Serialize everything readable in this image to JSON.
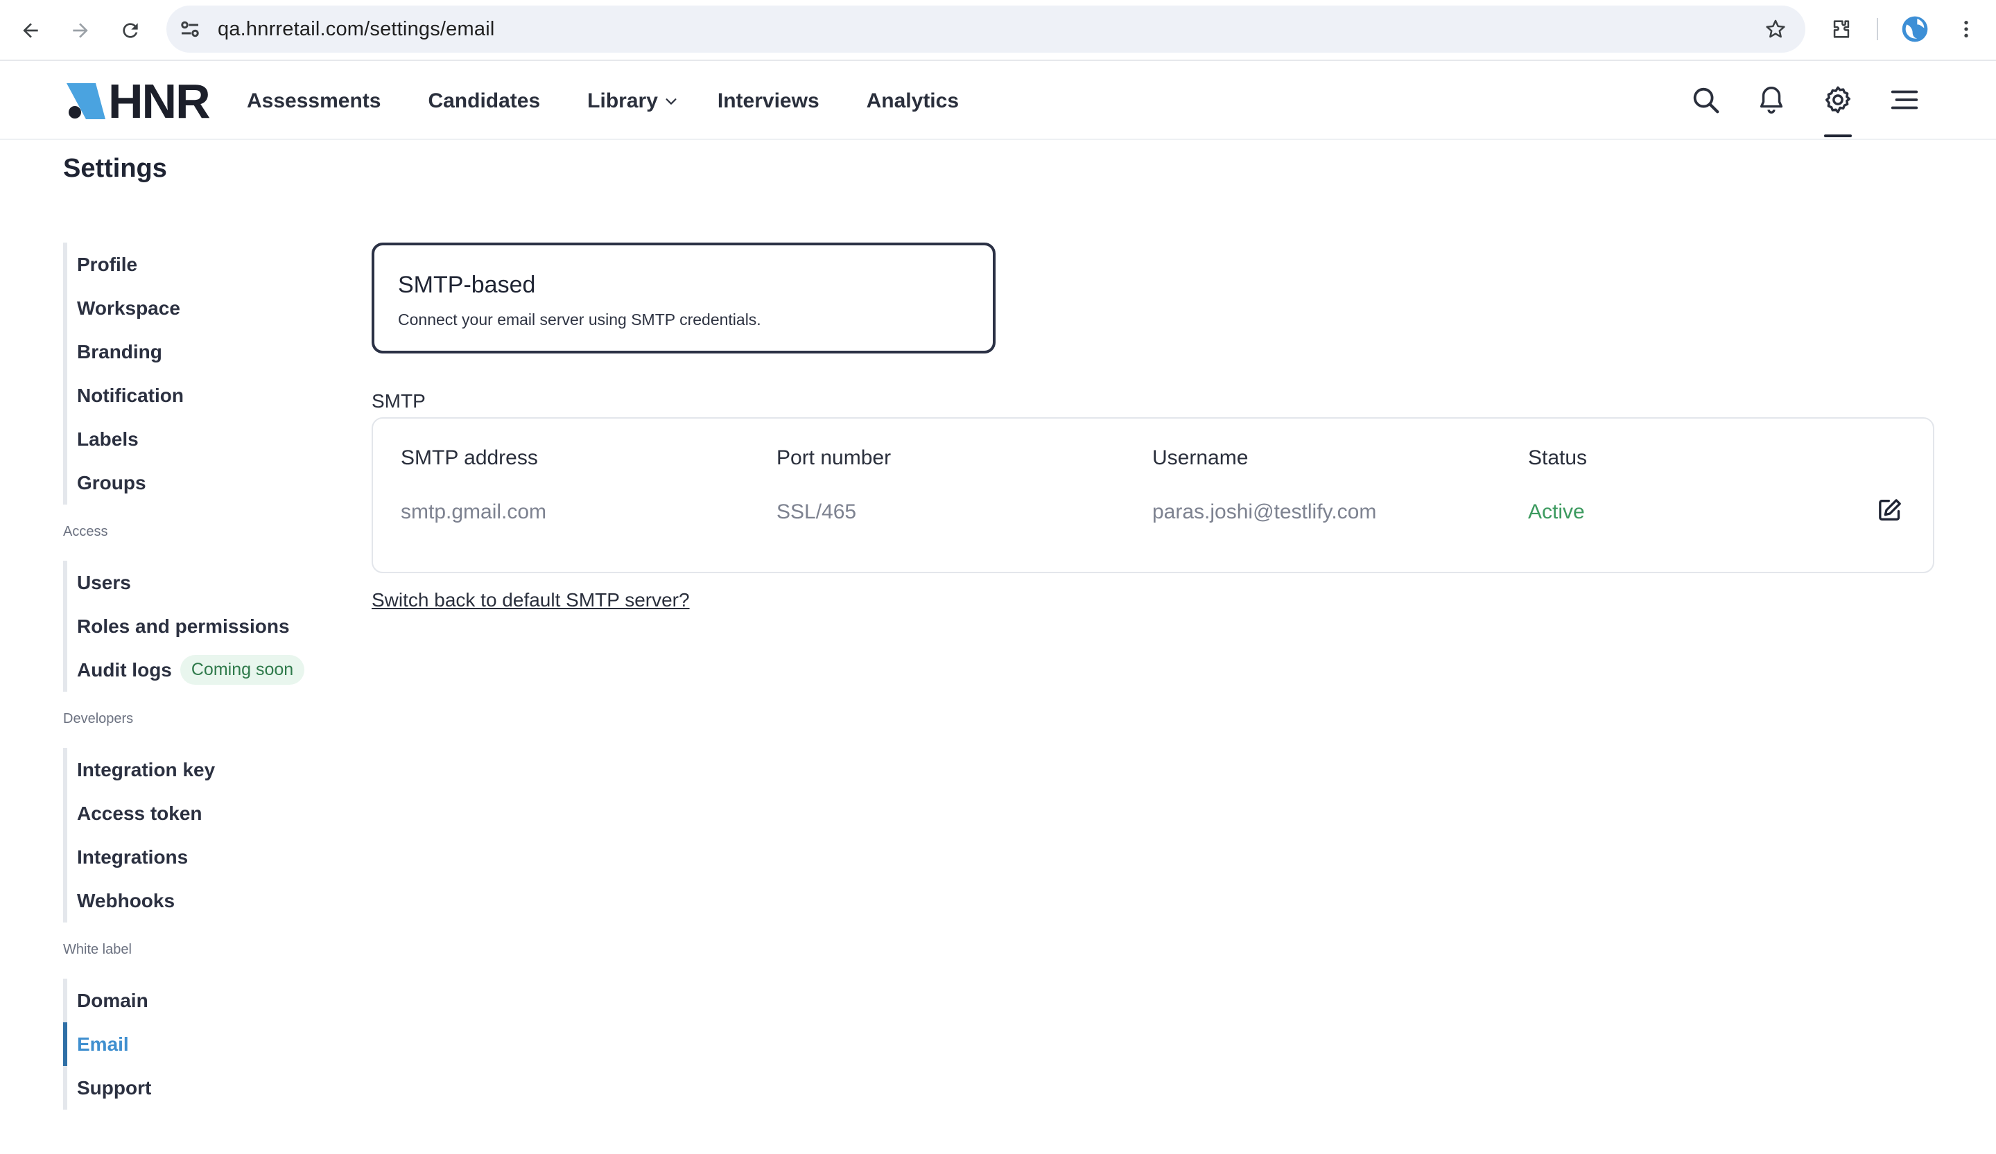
{
  "browser": {
    "url": "qa.hnrretail.com/settings/email"
  },
  "header": {
    "logo_text": "HNR",
    "nav": [
      "Assessments",
      "Candidates",
      "Library",
      "Interviews",
      "Analytics"
    ]
  },
  "page": {
    "title": "Settings"
  },
  "sidebar": {
    "group_main": [
      "Profile",
      "Workspace",
      "Branding",
      "Notification",
      "Labels",
      "Groups"
    ],
    "access_label": "Access",
    "group_access": [
      "Users",
      "Roles and permissions",
      "Audit logs"
    ],
    "audit_badge": "Coming soon",
    "developers_label": "Developers",
    "group_developers": [
      "Integration key",
      "Access token",
      "Integrations",
      "Webhooks"
    ],
    "white_label_label": "White label",
    "group_white_label": [
      "Domain",
      "Email",
      "Support"
    ],
    "selected": "Email"
  },
  "smtp_card": {
    "title": "SMTP-based",
    "description": "Connect your email server using SMTP credentials."
  },
  "smtp_section": {
    "label": "SMTP",
    "columns": [
      "SMTP address",
      "Port number",
      "Username",
      "Status"
    ],
    "row": {
      "address": "smtp.gmail.com",
      "port": "SSL/465",
      "username": "paras.joshi@testlify.com",
      "status": "Active"
    },
    "status_color": "#3c9a5f"
  },
  "switch_link": "Switch back to default SMTP server?",
  "colors": {
    "accent": "#3f8fcf",
    "logo_blue": "#4aa3e0",
    "badge_bg": "#e9f6ee"
  }
}
